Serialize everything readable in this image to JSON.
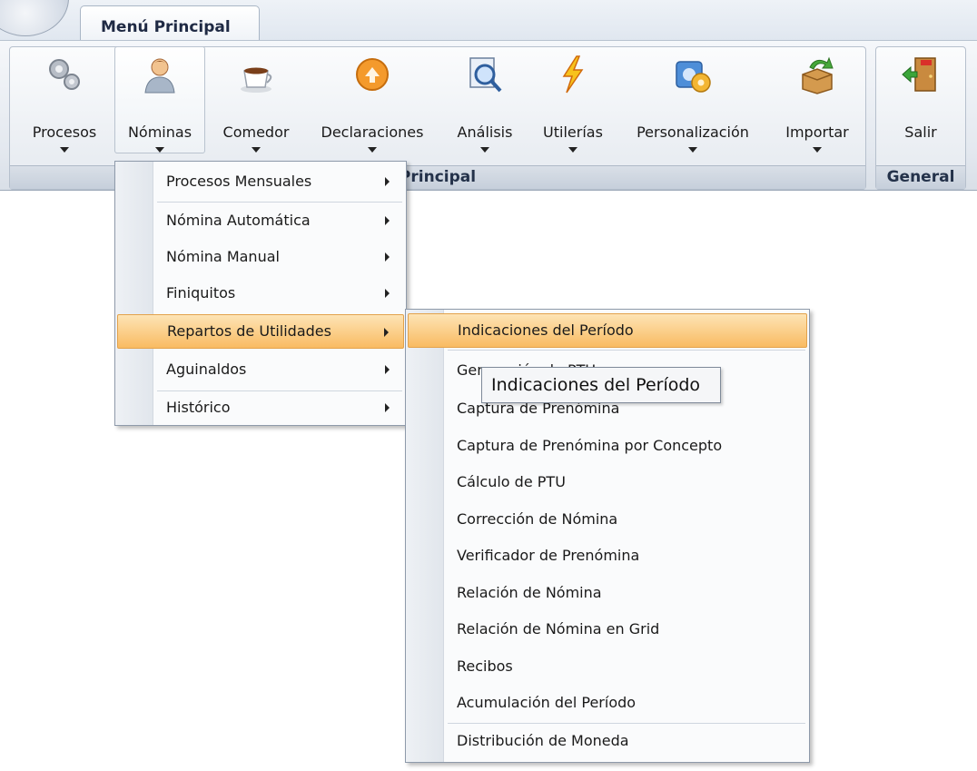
{
  "tabs": [
    {
      "label": "Menú Principal"
    }
  ],
  "ribbon": {
    "buttons": [
      {
        "label": "Procesos",
        "icon": "gears-icon"
      },
      {
        "label": "Nóminas",
        "icon": "user-icon"
      },
      {
        "label": "Comedor",
        "icon": "coffee-cup-icon"
      },
      {
        "label": "Declaraciones",
        "icon": "orange-arrow-icon"
      },
      {
        "label": "Análisis",
        "icon": "magnifier-icon"
      },
      {
        "label": "Utilerías",
        "icon": "lightning-icon"
      },
      {
        "label": "Personalización",
        "icon": "settings-icon"
      },
      {
        "label": "Importar",
        "icon": "import-box-icon"
      },
      {
        "label": "Salir",
        "icon": "exit-door-icon"
      }
    ],
    "groups": [
      {
        "caption": "Principal"
      },
      {
        "caption": "General"
      }
    ]
  },
  "nominas_menu": {
    "items": [
      {
        "label": "Procesos Mensuales"
      },
      {
        "label": "Nómina Automática"
      },
      {
        "label": "Nómina Manual"
      },
      {
        "label": "Finiquitos"
      },
      {
        "label": "Repartos de Utilidades"
      },
      {
        "label": "Aguinaldos"
      },
      {
        "label": "Histórico"
      }
    ]
  },
  "submenu": {
    "items": [
      {
        "label": "Indicaciones del Período"
      },
      {
        "label": "Generación de PTU"
      },
      {
        "label": "Captura de Prenómina"
      },
      {
        "label": "Captura de Prenómina por Concepto"
      },
      {
        "label": "Cálculo de PTU"
      },
      {
        "label": "Corrección de Nómina"
      },
      {
        "label": "Verificador de Prenómina"
      },
      {
        "label": "Relación de Nómina"
      },
      {
        "label": "Relación de Nómina en Grid"
      },
      {
        "label": "Recibos"
      },
      {
        "label": "Acumulación del Período"
      },
      {
        "label": "Distribución de Moneda"
      }
    ]
  },
  "tooltip": {
    "text": "Indicaciones del Período"
  },
  "colors": {
    "highlight": "#f9bb62",
    "ribbon": "#e3e8ef"
  }
}
